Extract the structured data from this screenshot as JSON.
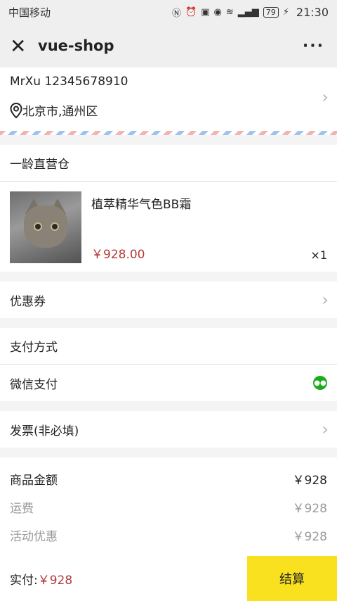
{
  "status_bar": {
    "carrier": "中国移动",
    "battery": "79",
    "time": "21:30"
  },
  "header": {
    "title": "vue-shop",
    "more": "···",
    "close": "✕"
  },
  "address": {
    "name_phone": "MrXu 12345678910",
    "location": "北京市,通州区"
  },
  "store": {
    "name": "一龄直营仓"
  },
  "product": {
    "name": "植萃精华气色BB霜",
    "price": "￥928.00",
    "qty": "×1"
  },
  "coupon": {
    "label": "优惠券"
  },
  "payment": {
    "header": "支付方式",
    "method": "微信支付"
  },
  "invoice": {
    "label": "发票(非必填)"
  },
  "summary": [
    {
      "label": "商品金额",
      "value": "￥928"
    },
    {
      "label": "运费",
      "value": "￥928"
    },
    {
      "label": "活动优惠",
      "value": "￥928"
    }
  ],
  "footer": {
    "paid_label": "实付:",
    "paid_amount": "￥928",
    "checkout": "结算"
  },
  "icons": {
    "chevron": "chevron-right-icon",
    "location": "location-pin-icon",
    "wechat": "wechat-pay-icon"
  },
  "colors": {
    "accent": "#f9e11f",
    "price": "#b43a3a"
  }
}
